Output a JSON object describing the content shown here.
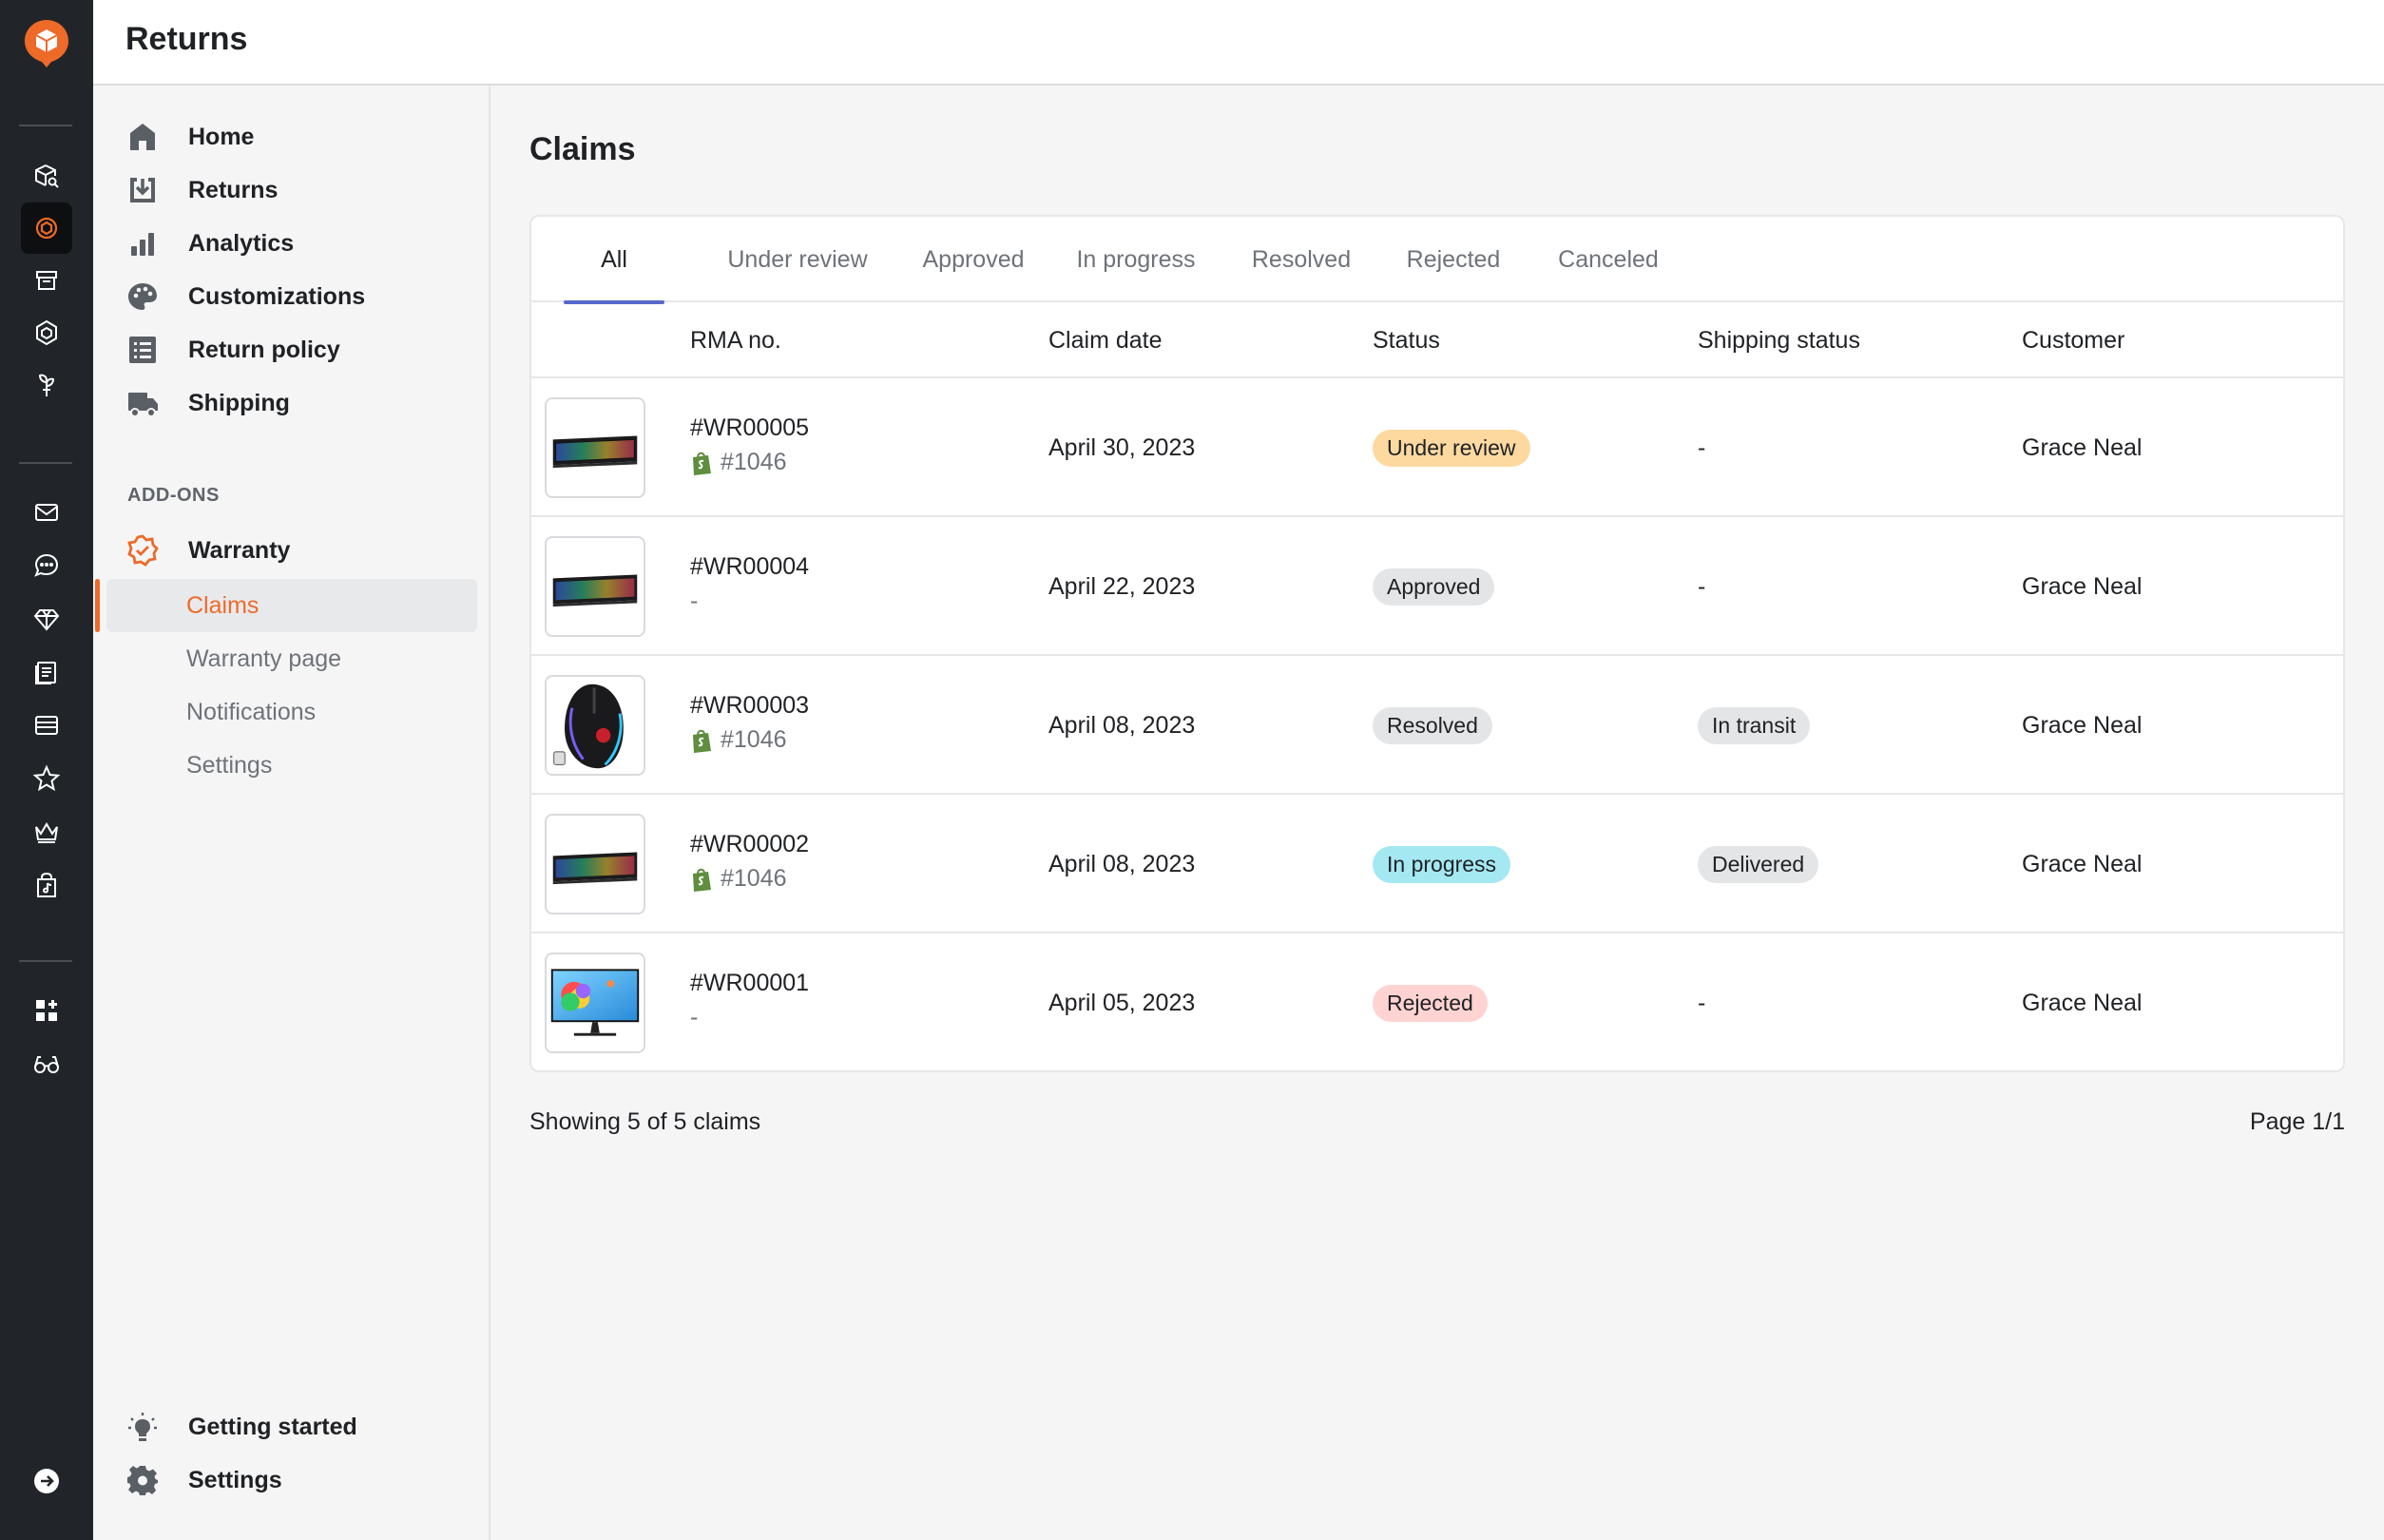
{
  "app": {
    "title": "Returns"
  },
  "rail": {
    "logo": "app-logo-icon",
    "items": [
      "package-search-icon",
      "returns-app-icon",
      "archive-box-icon",
      "shield-hex-icon",
      "plant-icon",
      "mail-icon",
      "chat-bubble-icon",
      "diamond-icon",
      "document-list-icon",
      "browser-window-icon",
      "star-icon",
      "crown-icon",
      "shopping-bag-icon",
      "apps-add-icon",
      "glasses-icon"
    ],
    "bottom": "arrow-right-circle-icon"
  },
  "sidebar": {
    "items": [
      {
        "label": "Home",
        "icon": "home-icon"
      },
      {
        "label": "Returns",
        "icon": "inbox-download-icon"
      },
      {
        "label": "Analytics",
        "icon": "bar-chart-icon"
      },
      {
        "label": "Customizations",
        "icon": "palette-icon"
      },
      {
        "label": "Return policy",
        "icon": "list-icon"
      },
      {
        "label": "Shipping",
        "icon": "truck-icon"
      }
    ],
    "addons_label": "ADD-ONS",
    "warranty": {
      "label": "Warranty",
      "icon": "badge-check-icon"
    },
    "sub_items": [
      "Claims",
      "Warranty page",
      "Notifications",
      "Settings"
    ],
    "active_sub_item": "Claims",
    "bottom_items": [
      {
        "label": "Getting started",
        "icon": "lightbulb-icon"
      },
      {
        "label": "Settings",
        "icon": "gear-icon"
      }
    ]
  },
  "main": {
    "title": "Claims",
    "tabs": [
      "All",
      "Under review",
      "Approved",
      "In progress",
      "Resolved",
      "Rejected",
      "Canceled"
    ],
    "active_tab": "All",
    "columns": [
      "RMA no.",
      "Claim date",
      "Status",
      "Shipping status",
      "Customer"
    ],
    "rows": [
      {
        "rma": "#WR00005",
        "order": "#1046",
        "has_shop_icon": true,
        "date": "April 30, 2023",
        "status": "Under review",
        "status_color": "#fdd9a0",
        "shipping": "-",
        "customer": "Grace Neal",
        "product": "keyboard"
      },
      {
        "rma": "#WR00004",
        "order": "-",
        "has_shop_icon": false,
        "date": "April 22, 2023",
        "status": "Approved",
        "status_color": "#e4e5e7",
        "shipping": "-",
        "customer": "Grace Neal",
        "product": "keyboard"
      },
      {
        "rma": "#WR00003",
        "order": "#1046",
        "has_shop_icon": true,
        "date": "April 08, 2023",
        "status": "Resolved",
        "status_color": "#e4e5e7",
        "shipping": "In transit",
        "customer": "Grace Neal",
        "product": "mouse"
      },
      {
        "rma": "#WR00002",
        "order": "#1046",
        "has_shop_icon": true,
        "date": "April 08, 2023",
        "status": "In progress",
        "status_color": "#a4e8f2",
        "shipping": "Delivered",
        "customer": "Grace Neal",
        "product": "keyboard"
      },
      {
        "rma": "#WR00001",
        "order": "-",
        "has_shop_icon": false,
        "date": "April 05, 2023",
        "status": "Rejected",
        "status_color": "#fed3d1",
        "shipping": "-",
        "customer": "Grace Neal",
        "product": "monitor"
      }
    ],
    "shipping_badge_color": "#e4e5e7",
    "footer_left": "Showing 5 of 5 claims",
    "footer_right": "Page 1/1"
  },
  "colors": {
    "accent": "#ed6a29",
    "tab_indicator": "#5868c9",
    "rail_bg": "#212529"
  }
}
